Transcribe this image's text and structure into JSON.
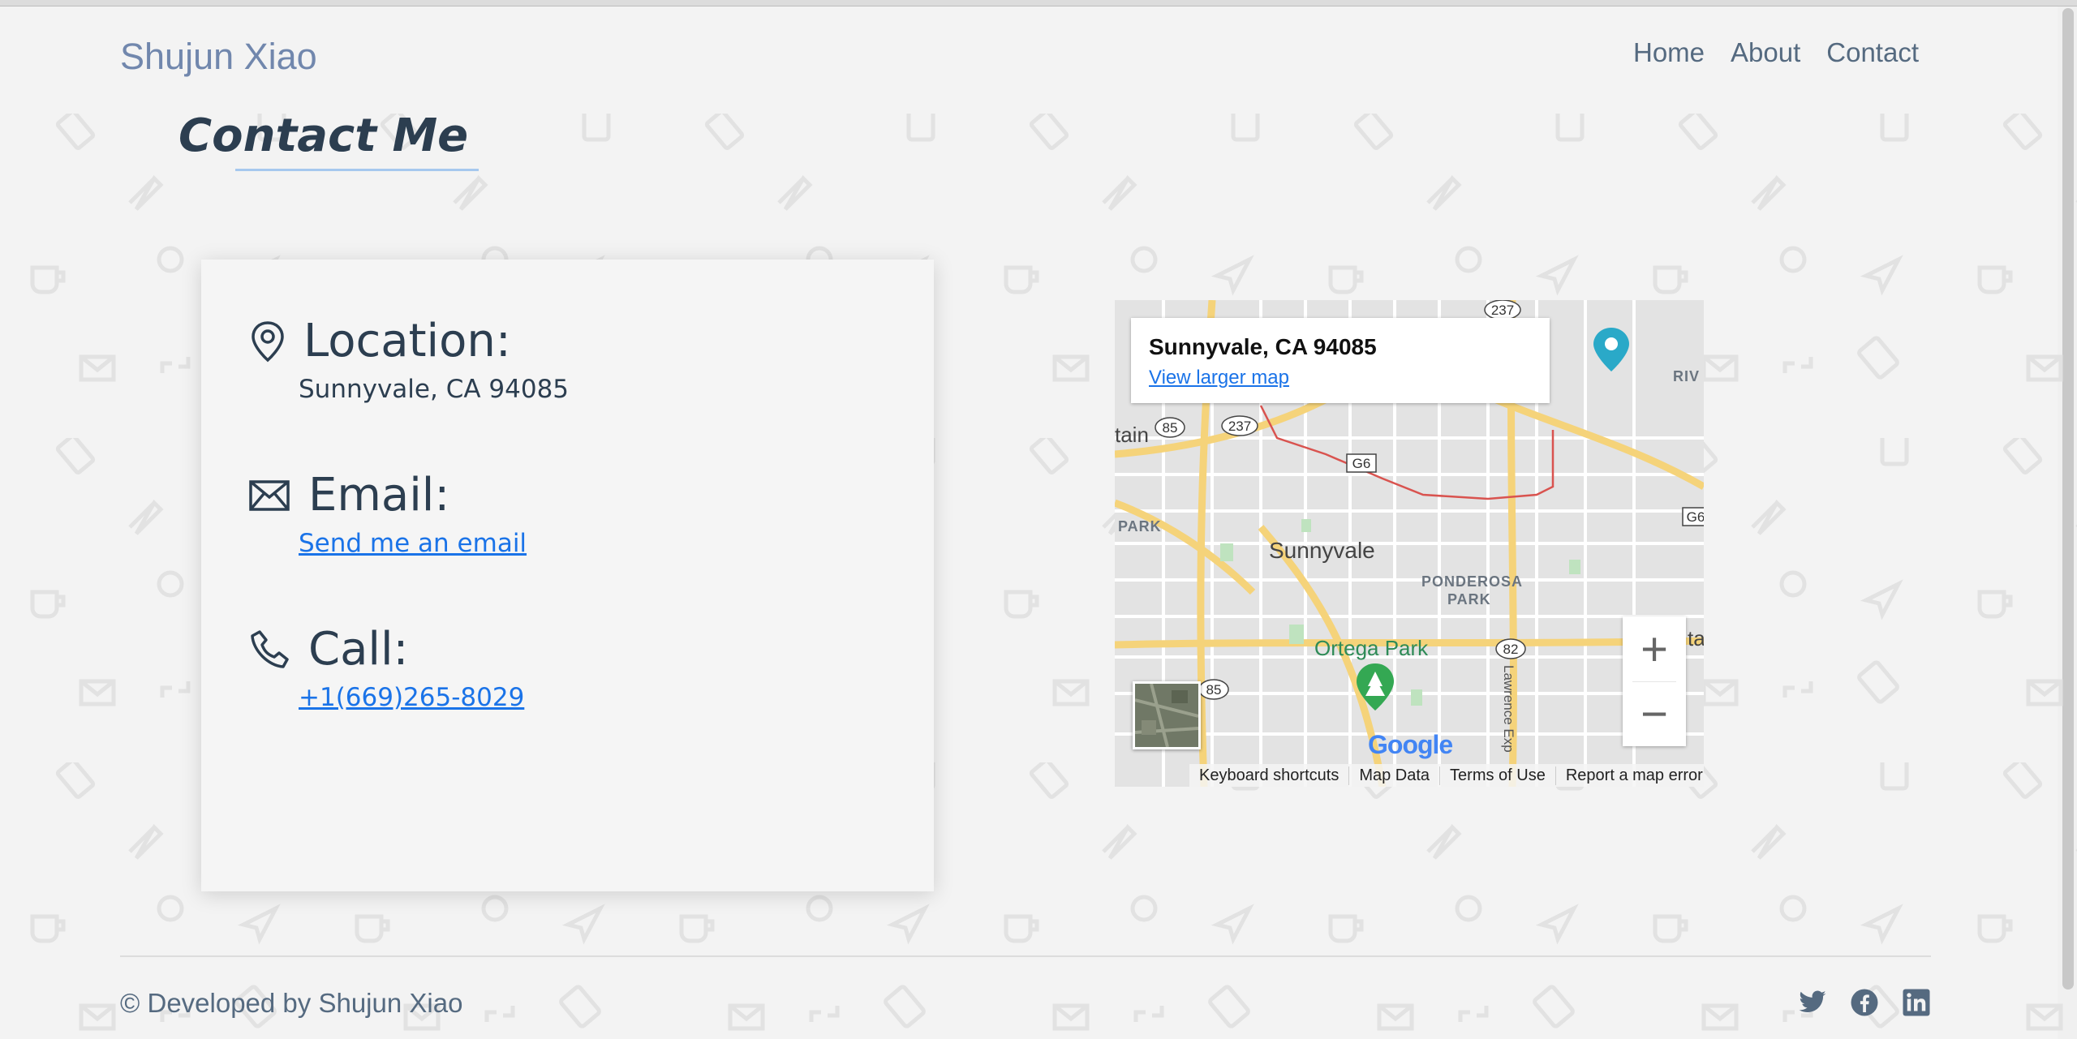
{
  "header": {
    "brand": "Shujun Xiao",
    "nav": [
      "Home",
      "About",
      "Contact"
    ]
  },
  "page_title": "Contact Me",
  "contact": {
    "location": {
      "heading": "Location:",
      "value": "Sunnyvale, CA 94085"
    },
    "email": {
      "heading": "Email:",
      "value": "Send me an email"
    },
    "call": {
      "heading": "Call:",
      "value": "+1(669)265-8029"
    }
  },
  "map": {
    "info_title": "Sunnyvale, CA 94085",
    "info_link": "View larger map",
    "labels": {
      "city": "Sunnyvale",
      "park": "Ortega Park",
      "ponderosa_1": "PONDEROSA",
      "ponderosa_2": "PARK",
      "park_left": "PARK",
      "riv": "RIV",
      "road": "Lawrence Exp",
      "tain": "tain",
      "right_a": "ta"
    },
    "shields": [
      "237",
      "85",
      "237",
      "G6",
      "G6",
      "82",
      "85"
    ],
    "footer": [
      "Keyboard shortcuts",
      "Map Data",
      "Terms of Use",
      "Report a map error"
    ],
    "logo": "Google",
    "zoom_in": "+",
    "zoom_out": "−"
  },
  "footer": {
    "copyright": "© Developed by Shujun Xiao",
    "social": [
      "twitter-icon",
      "facebook-icon",
      "linkedin-icon"
    ]
  },
  "colors": {
    "accent": "#1a73e8",
    "brand": "#7187ad",
    "text": "#2c3e50"
  }
}
